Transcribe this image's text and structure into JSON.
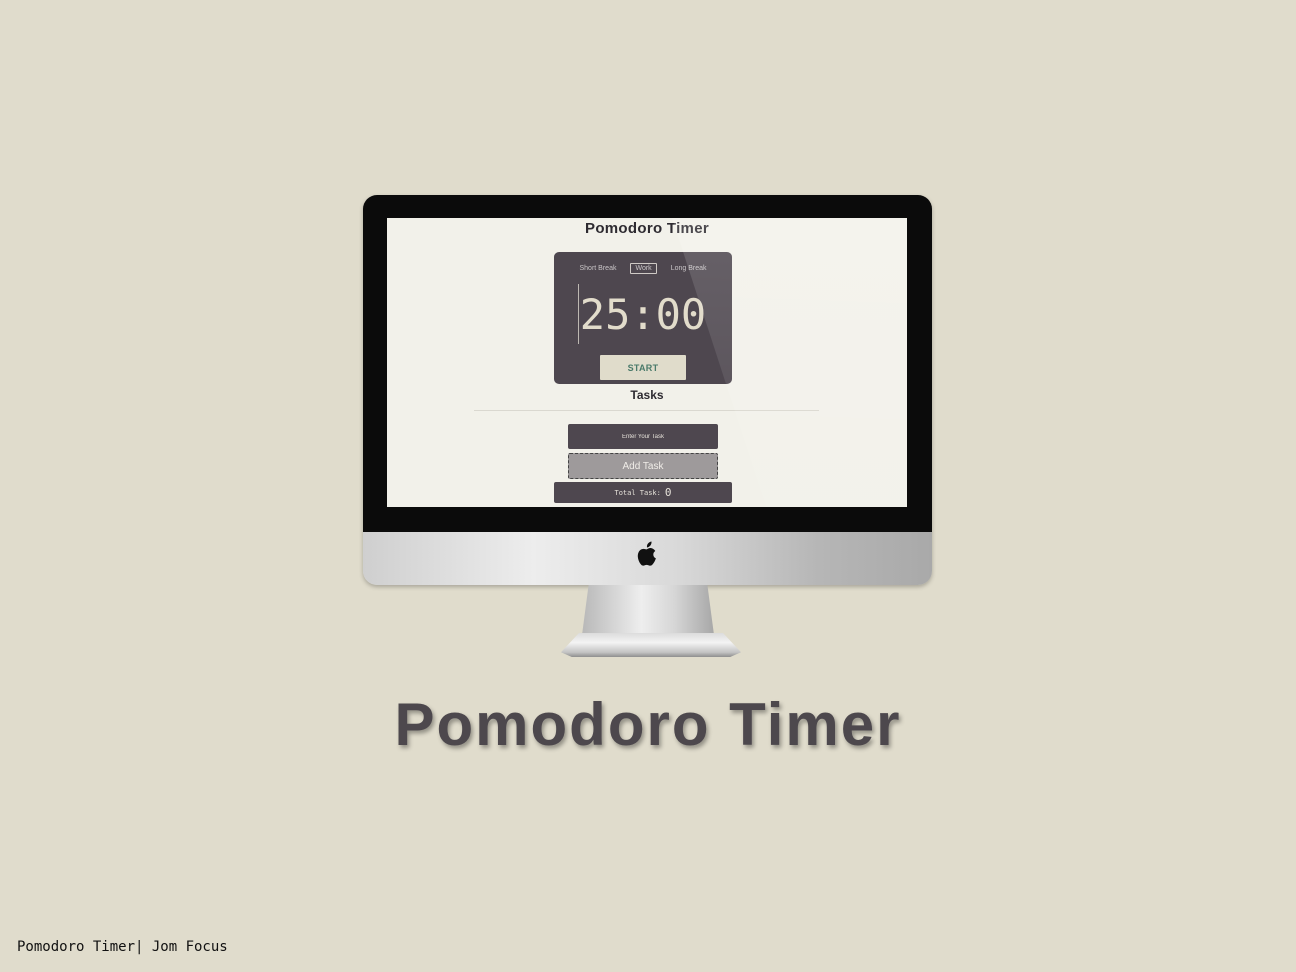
{
  "screen": {
    "app_title": "Pomodoro Timer",
    "modes": [
      "Short Break",
      "Work",
      "Long Break"
    ],
    "active_mode": "Work",
    "time": "25:00",
    "start_label": "START",
    "tasks_heading": "Tasks",
    "task_input_placeholder": "Enter Your Task",
    "add_task_label": "Add Task",
    "total_label": "Total Task:",
    "total_count": "0"
  },
  "hero_title": "Pomodoro Timer",
  "footer": "Pomodoro Timer| Jom Focus",
  "colors": {
    "page_background": "#e0dccc",
    "card": "#4e474f",
    "start_button_bg": "#e0dccb",
    "start_button_text": "#4a7a6a",
    "screen_background": "#f2f1ea"
  },
  "icons": [
    "apple-icon"
  ]
}
